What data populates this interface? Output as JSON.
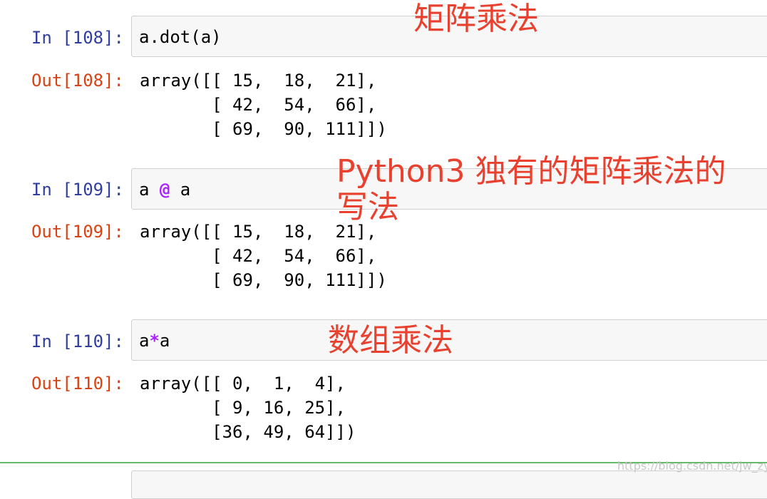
{
  "cells": [
    {
      "in_prompt": "In [108]:",
      "code": "a.dot(a)",
      "out_prompt": "Out[108]:",
      "output_lines": [
        "array([[ 15,  18,  21],",
        "       [ 42,  54,  66],",
        "       [ 69,  90, 111]])"
      ],
      "annotation_lines": [
        "矩阵乘法"
      ]
    },
    {
      "in_prompt": "In [109]:",
      "code_parts": [
        "a ",
        "@",
        " a"
      ],
      "out_prompt": "Out[109]:",
      "output_lines": [
        "array([[ 15,  18,  21],",
        "       [ 42,  54,  66],",
        "       [ 69,  90, 111]])"
      ],
      "annotation_lines": [
        "Python3 独有的矩阵乘法的",
        "写法"
      ]
    },
    {
      "in_prompt": "In [110]:",
      "code_parts": [
        "a",
        "*",
        "a"
      ],
      "out_prompt": "Out[110]:",
      "output_lines": [
        "array([[ 0,  1,  4],",
        "       [ 9, 16, 25],",
        "       [36, 49, 64]])"
      ],
      "annotation_lines": [
        "数组乘法"
      ]
    }
  ],
  "watermark": "https://blog.csdn.net/jw_zyfx",
  "colors": {
    "in_prompt": "#303f9f",
    "out_prompt": "#d84315",
    "operator": "#aa22ff",
    "annotation": "#e8412f",
    "selected_cell_border": "#66bb6a"
  }
}
